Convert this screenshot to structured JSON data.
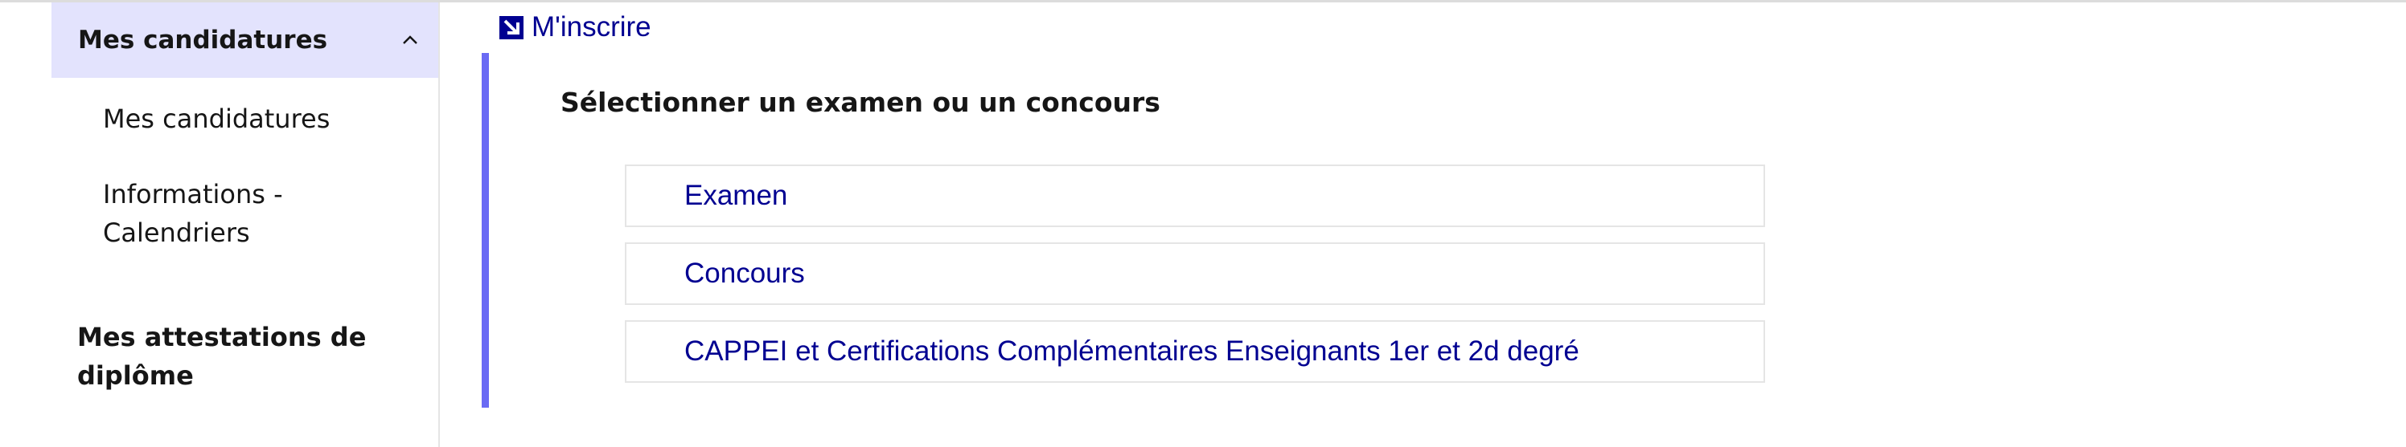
{
  "sidebar": {
    "section_title": "Mes candidatures",
    "items": [
      {
        "label": "Mes candidatures"
      },
      {
        "label": "Informations - Calendriers"
      }
    ],
    "attestations_title": "Mes attestations de diplôme"
  },
  "main": {
    "inscrire_link": "M'inscrire",
    "select_title": "Sélectionner un examen ou un concours",
    "options": [
      {
        "label": "Examen"
      },
      {
        "label": "Concours"
      },
      {
        "label": "CAPPEI et Certifications Complémentaires Enseignants 1er et 2d degré"
      }
    ]
  },
  "icons": {
    "collapse": "chevron-up-icon",
    "inscrire": "arrow-down-right-icon"
  },
  "colors": {
    "link": "#000091",
    "accent": "#6a6af4",
    "active_bg": "#e3e3fd"
  }
}
